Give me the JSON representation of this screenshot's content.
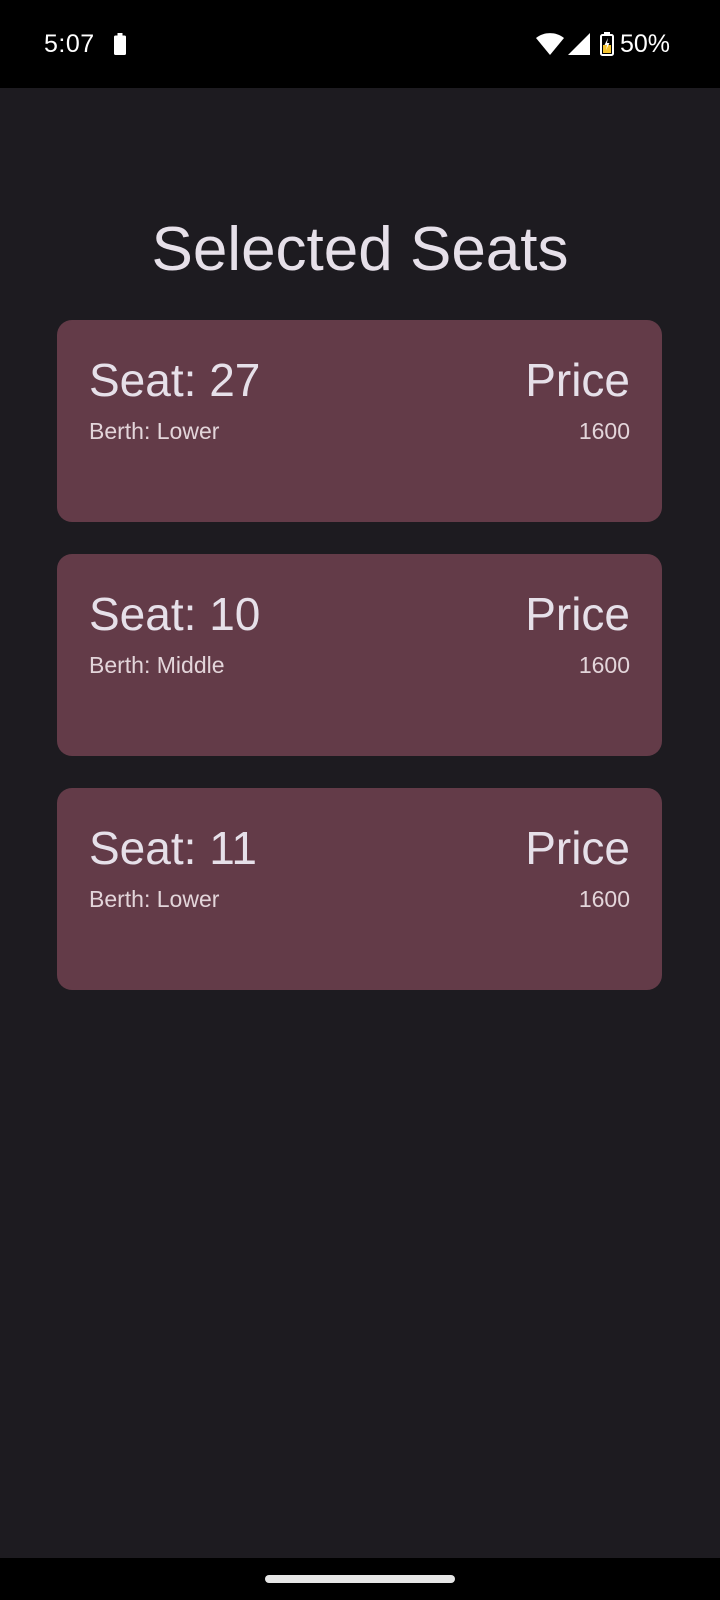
{
  "status_bar": {
    "time": "5:07",
    "battery_percent": "50%",
    "icons": [
      "battery-icon",
      "wifi-icon",
      "signal-icon",
      "battery-charging-icon"
    ]
  },
  "page": {
    "title": "Selected Seats"
  },
  "seats": [
    {
      "seat": "Seat: 27",
      "berth": "Berth: Lower",
      "price_label": "Price",
      "price": "1600"
    },
    {
      "seat": "Seat: 10",
      "berth": "Berth: Middle",
      "price_label": "Price",
      "price": "1600"
    },
    {
      "seat": "Seat: 11",
      "berth": "Berth: Lower",
      "price_label": "Price",
      "price": "1600"
    }
  ],
  "colors": {
    "background": "#1d1b20",
    "card": "#633b48",
    "text": "#e6e0e9",
    "status_bar": "#000000",
    "battery_accent": "#f4c430"
  }
}
